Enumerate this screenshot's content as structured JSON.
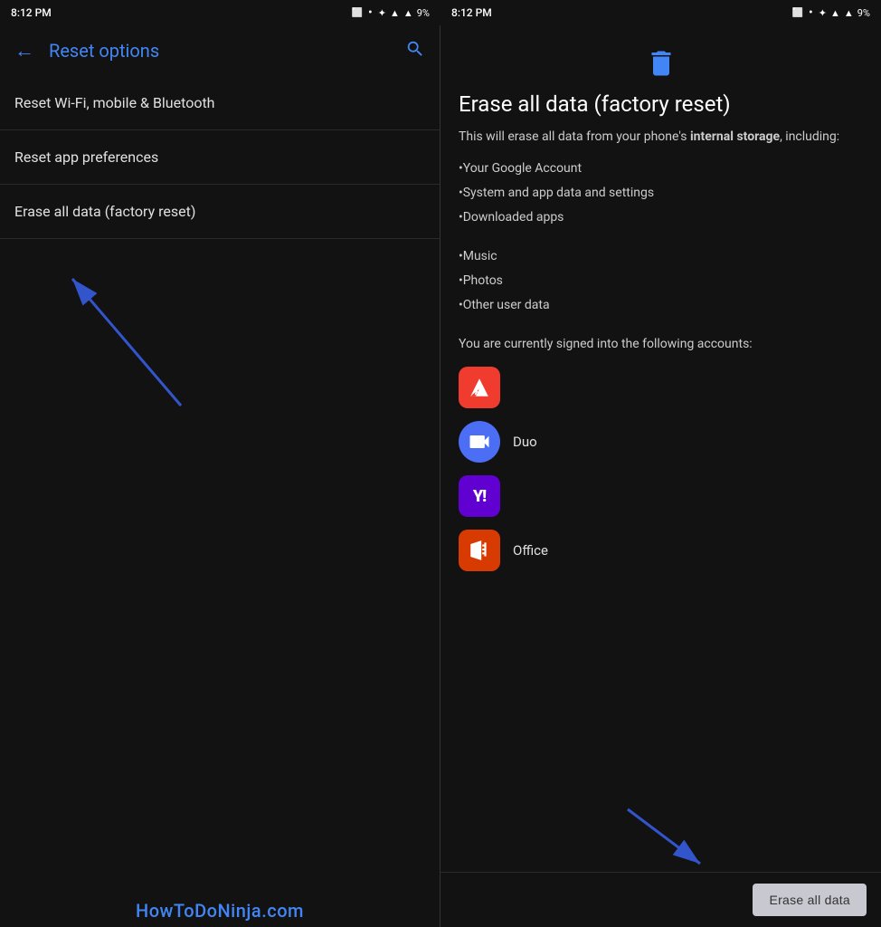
{
  "left_panel": {
    "status_bar": {
      "time": "8:12 PM",
      "battery": "9%",
      "dot": "•"
    },
    "title": "Reset options",
    "back_label": "←",
    "search_label": "🔍",
    "menu_items": [
      {
        "id": "wifi",
        "label": "Reset Wi-Fi, mobile & Bluetooth"
      },
      {
        "id": "app",
        "label": "Reset app preferences"
      },
      {
        "id": "factory",
        "label": "Erase all data (factory reset)"
      }
    ],
    "watermark": "HowToDoNinja.com"
  },
  "right_panel": {
    "status_bar": {
      "time": "8:12 PM",
      "battery": "9%",
      "dot": "•"
    },
    "icon": "🗑",
    "title": "Erase all data (factory reset)",
    "description_prefix": "This will erase all data from your phone's ",
    "description_bold": "internal storage",
    "description_suffix": ", including:",
    "bullets": [
      "•Your Google Account",
      "•System and app data and settings",
      "•Downloaded apps",
      "•Music",
      "•Photos",
      "•Other user data"
    ],
    "accounts_text": "You are currently signed into the following accounts:",
    "accounts": [
      {
        "id": "adobe",
        "type": "adobe",
        "label": "A",
        "name": ""
      },
      {
        "id": "duo",
        "type": "duo",
        "label": "▶",
        "name": "Duo"
      },
      {
        "id": "yahoo",
        "type": "yahoo",
        "label": "Y!",
        "name": ""
      },
      {
        "id": "office",
        "type": "office",
        "label": "O",
        "name": "Office"
      }
    ],
    "erase_button_label": "Erase all data"
  }
}
